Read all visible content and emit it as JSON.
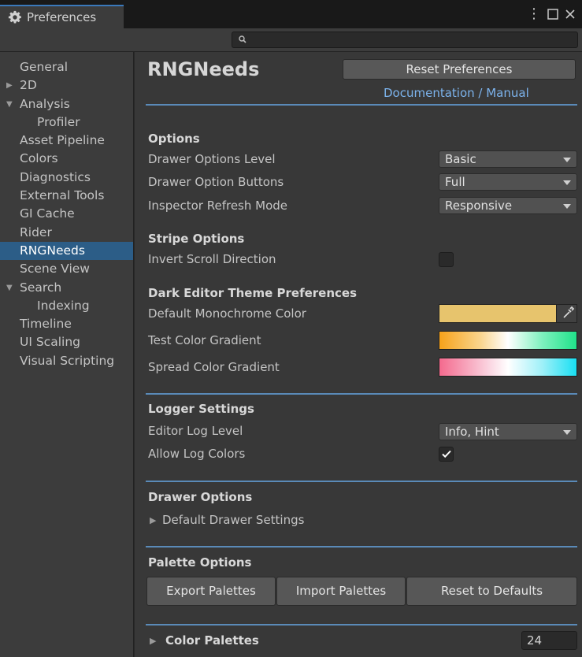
{
  "window": {
    "tab_title": "Preferences",
    "search": {
      "value": "",
      "placeholder": ""
    }
  },
  "sidebar": {
    "items": [
      {
        "label": "General"
      },
      {
        "label": "2D"
      },
      {
        "label": "Analysis"
      },
      {
        "label": "Profiler"
      },
      {
        "label": "Asset Pipeline"
      },
      {
        "label": "Colors"
      },
      {
        "label": "Diagnostics"
      },
      {
        "label": "External Tools"
      },
      {
        "label": "GI Cache"
      },
      {
        "label": "Rider"
      },
      {
        "label": "RNGNeeds"
      },
      {
        "label": "Scene View"
      },
      {
        "label": "Search"
      },
      {
        "label": "Indexing"
      },
      {
        "label": "Timeline"
      },
      {
        "label": "UI Scaling"
      },
      {
        "label": "Visual Scripting"
      }
    ],
    "selected": "RNGNeeds"
  },
  "main": {
    "title": "RNGNeeds",
    "reset_preferences": "Reset Preferences",
    "doc_link": "Documentation / Manual",
    "options": {
      "header": "Options",
      "drawer_options_level": {
        "label": "Drawer Options Level",
        "value": "Basic"
      },
      "drawer_option_buttons": {
        "label": "Drawer Option Buttons",
        "value": "Full"
      },
      "inspector_refresh_mode": {
        "label": "Inspector Refresh Mode",
        "value": "Responsive"
      }
    },
    "stripe": {
      "header": "Stripe Options",
      "invert_scroll": {
        "label": "Invert Scroll Direction",
        "checked": false
      }
    },
    "theme": {
      "header": "Dark Editor Theme Preferences",
      "mono_color": {
        "label": "Default Monochrome Color",
        "color": "#e7c46d"
      },
      "test_gradient": {
        "label": "Test Color Gradient"
      },
      "spread_gradient": {
        "label": "Spread Color Gradient"
      }
    },
    "logger": {
      "header": "Logger Settings",
      "log_level": {
        "label": "Editor Log Level",
        "value": "Info, Hint"
      },
      "log_colors": {
        "label": "Allow Log Colors",
        "checked": true
      }
    },
    "drawer": {
      "header": "Drawer Options",
      "default_settings": "Default Drawer Settings"
    },
    "palette": {
      "header": "Palette Options",
      "export": "Export Palettes",
      "import": "Import Palettes",
      "reset": "Reset to Defaults"
    },
    "color_palettes": {
      "label": "Color Palettes",
      "count": "24"
    }
  },
  "colors": {
    "accent": "#2c5d87",
    "link": "#7cb3ec",
    "separator": "#5a8ab8"
  }
}
